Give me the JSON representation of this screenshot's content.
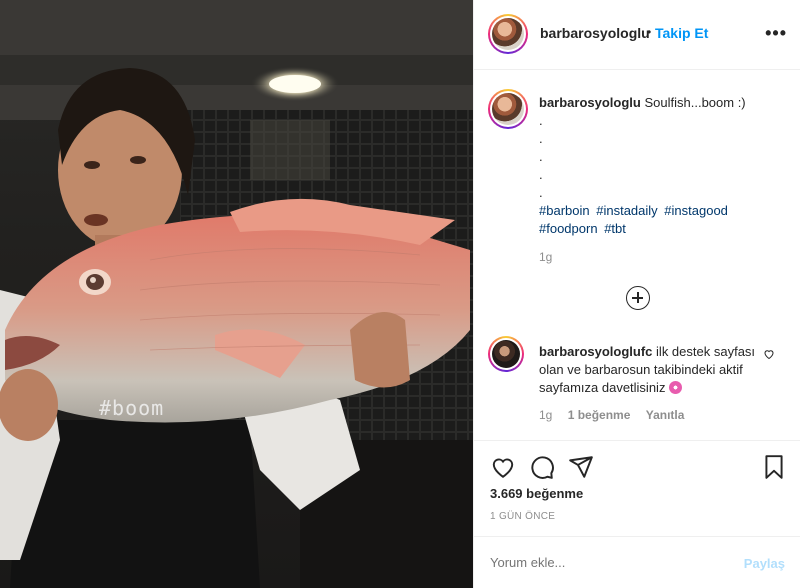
{
  "photo": {
    "overlay_tag": "#boom"
  },
  "header": {
    "username": "barbarosyologlu",
    "separator": "•",
    "follow_label": "Takip Et",
    "more_label": "•••"
  },
  "caption": {
    "username": "barbarosyologlu",
    "text": "Soulfish...boom :)",
    "dot_lines": [
      ".",
      ".",
      ".",
      ".",
      "."
    ],
    "hashtags": [
      "#barboin",
      "#instadaily",
      "#instagood",
      "#foodporn",
      "#tbt"
    ],
    "age": "1g"
  },
  "comment": {
    "username": "barbarosyologlufc",
    "text": "ilk destek sayfası olan ve barbarosun takibindeki aktif sayfamıza davetlisiniz",
    "age": "1g",
    "likes": "1 beğenme",
    "reply_label": "Yanıtla"
  },
  "actions": {
    "like_icon": "heart-icon",
    "comment_icon": "comment-icon",
    "share_icon": "paper-plane-icon",
    "save_icon": "bookmark-icon"
  },
  "stats": {
    "likes": "3.669 beğenme",
    "date": "1 GÜN ÖNCE"
  },
  "add_comment": {
    "placeholder": "Yorum ekle...",
    "post_label": "Paylaş"
  },
  "colors": {
    "accent": "#0095f6",
    "hashtag": "#00376b",
    "muted": "#8e8e8e",
    "post_disabled": "#b2dffc"
  }
}
